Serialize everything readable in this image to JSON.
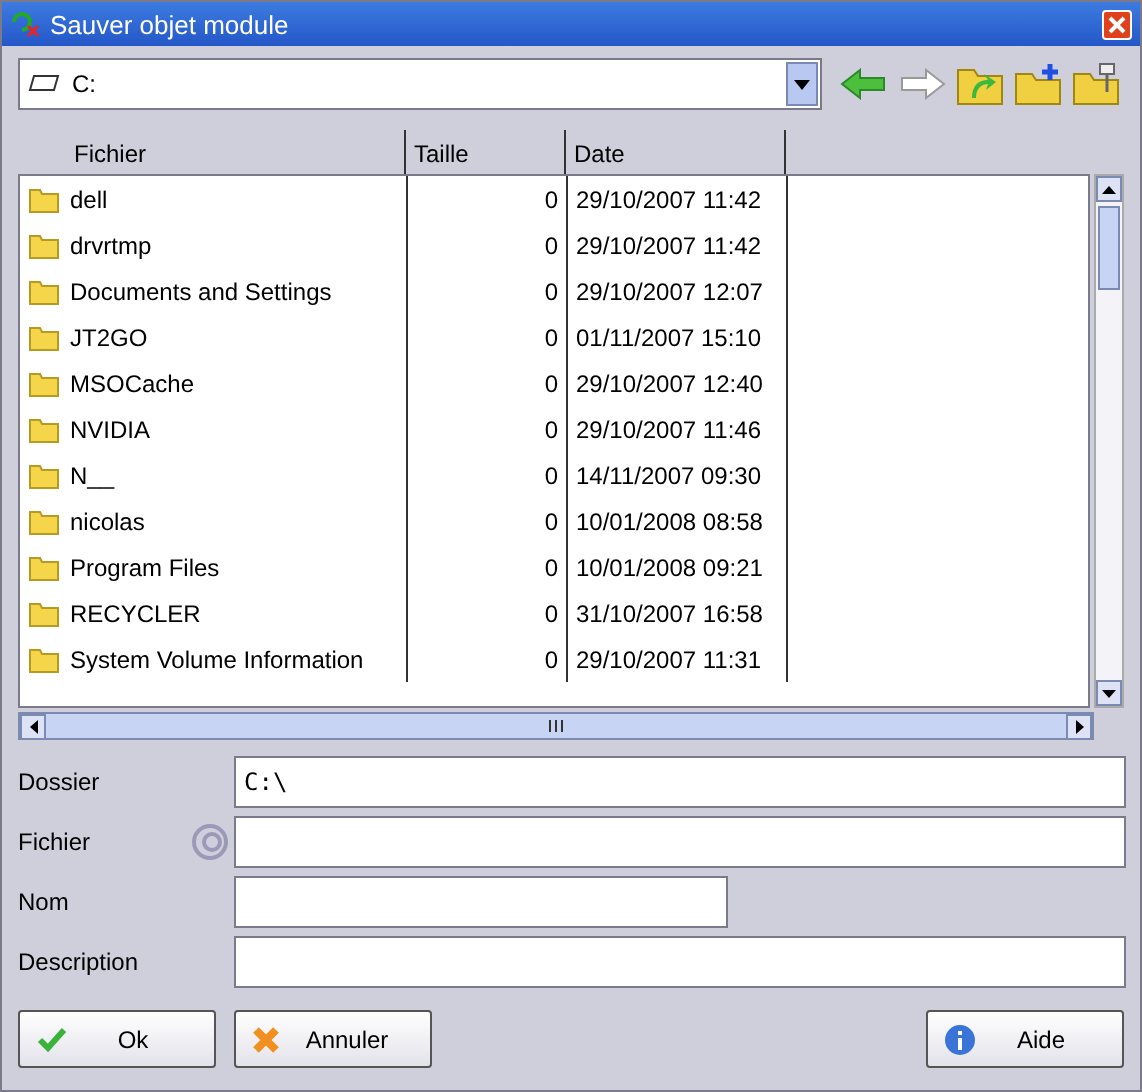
{
  "window": {
    "title": "Sauver objet module"
  },
  "location": {
    "value": "C:"
  },
  "table": {
    "columns": [
      "Fichier",
      "Taille",
      "Date"
    ],
    "rows": [
      {
        "name": "dell",
        "size": "0",
        "date": "29/10/2007 11:42"
      },
      {
        "name": "drvrtmp",
        "size": "0",
        "date": "29/10/2007 11:42"
      },
      {
        "name": "Documents and Settings",
        "size": "0",
        "date": "29/10/2007 12:07"
      },
      {
        "name": "JT2GO",
        "size": "0",
        "date": "01/11/2007 15:10"
      },
      {
        "name": "MSOCache",
        "size": "0",
        "date": "29/10/2007 12:40"
      },
      {
        "name": "NVIDIA",
        "size": "0",
        "date": "29/10/2007 11:46"
      },
      {
        "name": "N__",
        "size": "0",
        "date": "14/11/2007 09:30"
      },
      {
        "name": "nicolas",
        "size": "0",
        "date": "10/01/2008 08:58"
      },
      {
        "name": "Program Files",
        "size": "0",
        "date": "10/01/2008 09:21"
      },
      {
        "name": "RECYCLER",
        "size": "0",
        "date": "31/10/2007 16:58"
      },
      {
        "name": "System Volume Information",
        "size": "0",
        "date": "29/10/2007 11:31"
      }
    ]
  },
  "form": [
    {
      "label": "Dossier",
      "value": "C:\\",
      "kind": "wide"
    },
    {
      "label": "Fichier",
      "kind": "wide-icon"
    },
    {
      "label": "Nom",
      "kind": "short"
    },
    {
      "label": "Description",
      "kind": "wide"
    }
  ],
  "buttons": [
    {
      "label": "Ok",
      "kind": "ok"
    },
    {
      "label": "Annuler",
      "kind": "cancel"
    },
    {
      "label": "Aide",
      "kind": "help"
    }
  ]
}
